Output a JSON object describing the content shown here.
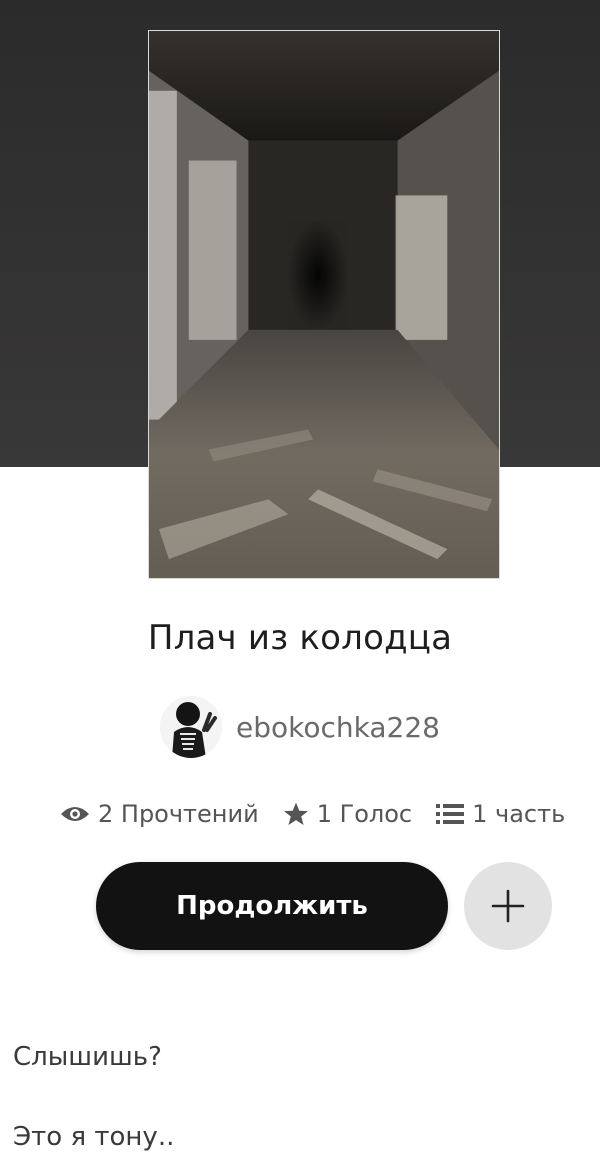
{
  "story": {
    "title": "Плач из колодца",
    "author": "ebokochka228"
  },
  "stats": {
    "reads_label": "2 Прочтений",
    "votes_label": "1 Голос",
    "parts_label": "1 часть"
  },
  "actions": {
    "continue_label": "Продолжить",
    "add_icon": "plus-icon"
  },
  "excerpt": {
    "lines": [
      "Слышишь?",
      "Это я тону.."
    ]
  },
  "colors": {
    "hero_background": "#333232",
    "continue_button": "#121212",
    "add_button": "#e2e2e2",
    "stat_text": "#555555"
  }
}
